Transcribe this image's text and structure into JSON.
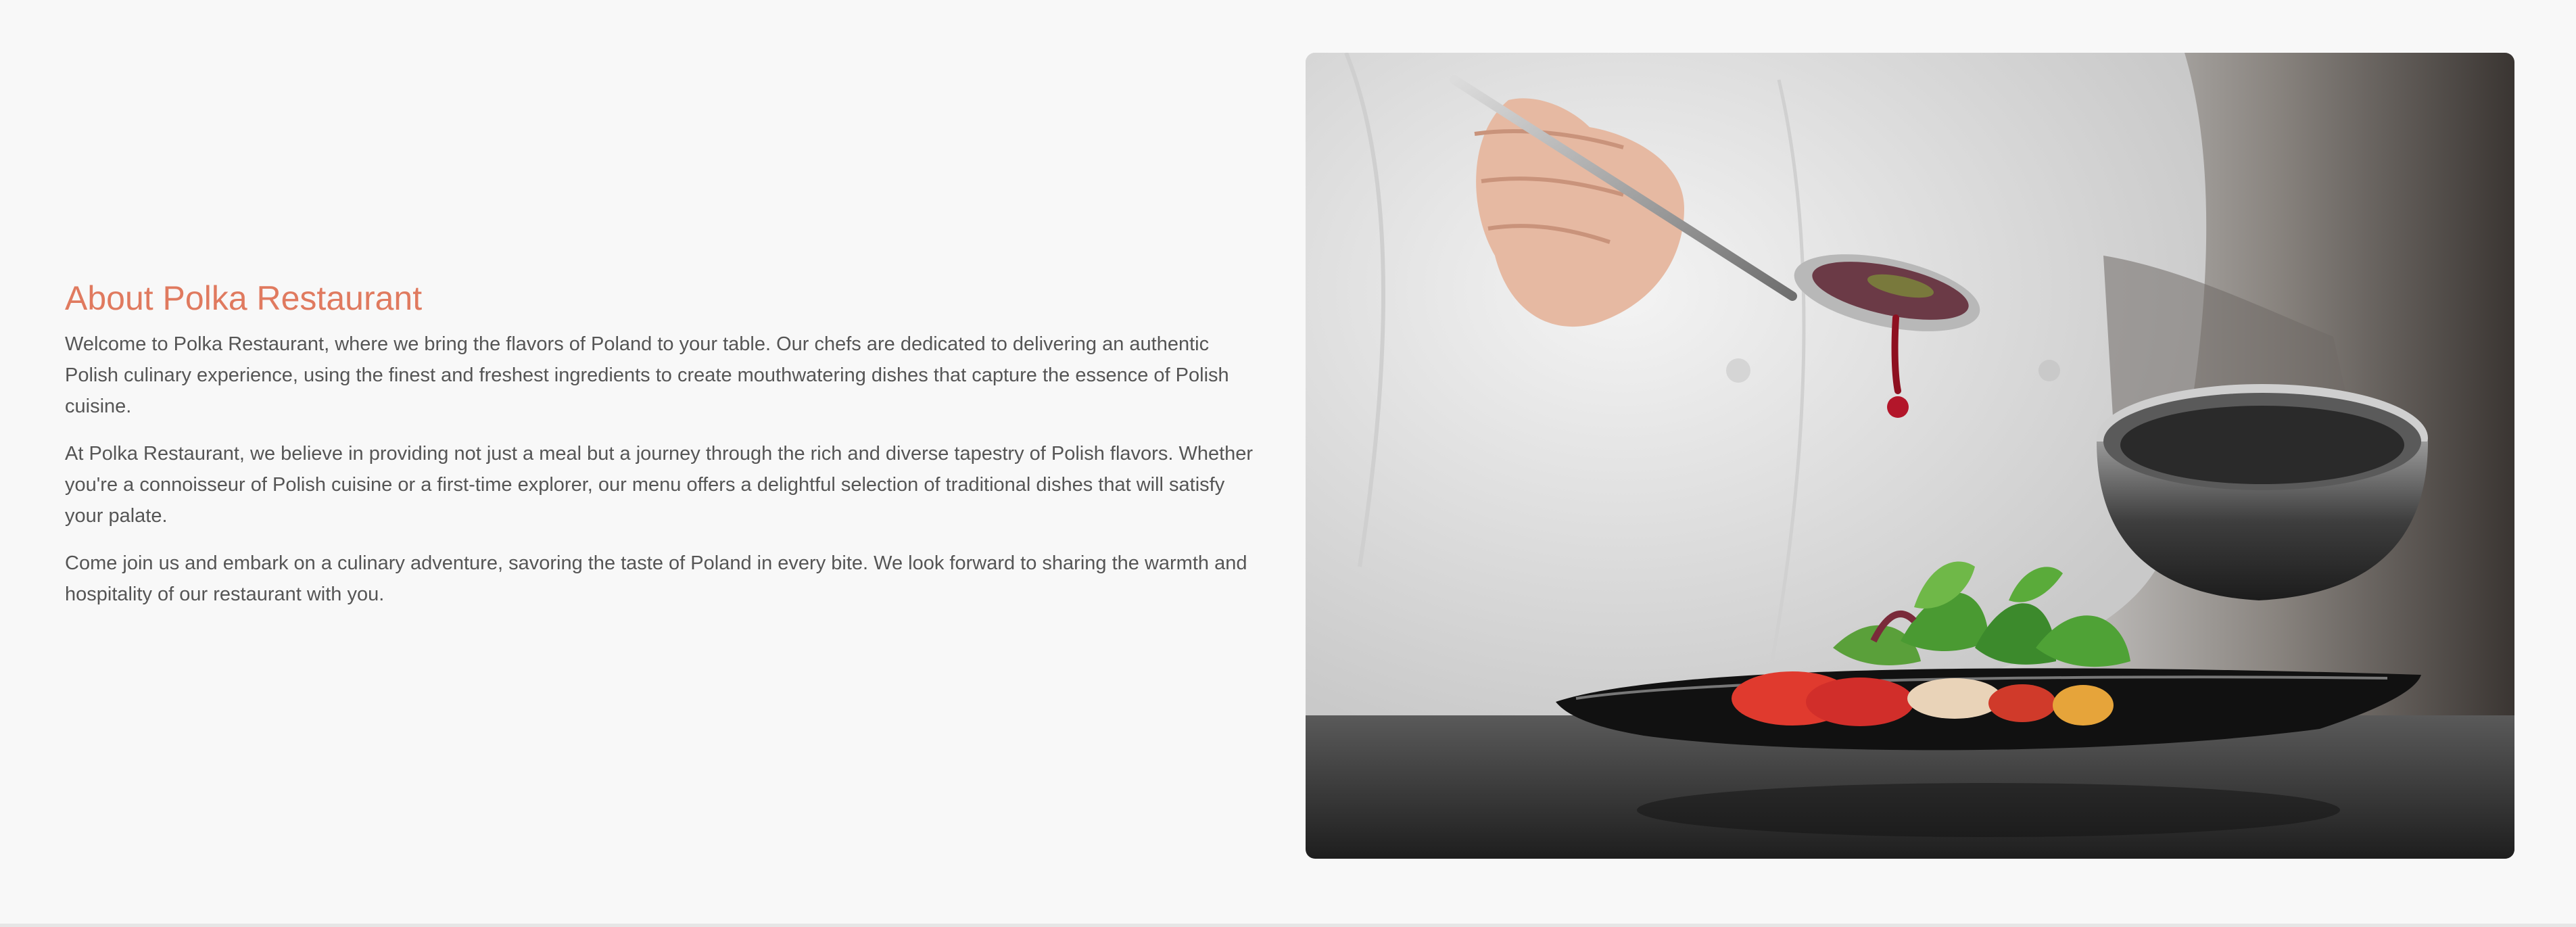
{
  "about": {
    "title": "About Polka Restaurant",
    "paragraphs": [
      "Welcome to Polka Restaurant, where we bring the flavors of Poland to your table. Our chefs are dedicated to delivering an authentic Polish culinary experience, using the finest and freshest ingredients to create mouthwatering dishes that capture the essence of Polish cuisine.",
      "At Polka Restaurant, we believe in providing not just a meal but a journey through the rich and diverse tapestry of Polish flavors. Whether you're a connoisseur of Polish cuisine or a first-time explorer, our menu offers a delightful selection of traditional dishes that will satisfy your palate.",
      "Come join us and embark on a culinary adventure, savoring the taste of Poland in every bite. We look forward to sharing the warmth and hospitality of our restaurant with you."
    ]
  },
  "colors": {
    "accent": "#e07a5f",
    "body_text": "#555555",
    "background": "#f8f8f8"
  }
}
